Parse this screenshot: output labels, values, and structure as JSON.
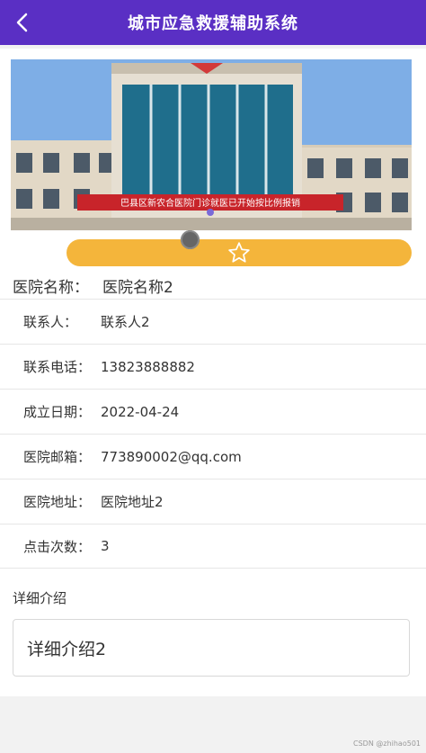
{
  "header": {
    "title": "城市应急救援辅助系统",
    "back_icon": "chevron-left-icon"
  },
  "banner": {
    "sign_text": "巴县区新农合医院门诊就医已开始按比例报销",
    "image_desc": "hospital-building-photo"
  },
  "favorite": {
    "icon": "star-outline-icon"
  },
  "detail": {
    "title_label": "医院名称：",
    "title_value": "医院名称2",
    "fields": [
      {
        "label": "联系人：",
        "value": "联系人2"
      },
      {
        "label": "联系电话：",
        "value": "13823888882"
      },
      {
        "label": "成立日期：",
        "value": "2022-04-24"
      },
      {
        "label": "医院邮箱：",
        "value": "773890002@qq.com"
      },
      {
        "label": "医院地址：",
        "value": "医院地址2"
      },
      {
        "label": "点击次数：",
        "value": "3"
      }
    ],
    "intro_label": "详细介绍",
    "intro_value": "详细介绍2"
  },
  "watermark": "CSDN @zhihao501",
  "colors": {
    "header_bg": "#5a2fc4",
    "fav_bar": "#f4b53b"
  }
}
